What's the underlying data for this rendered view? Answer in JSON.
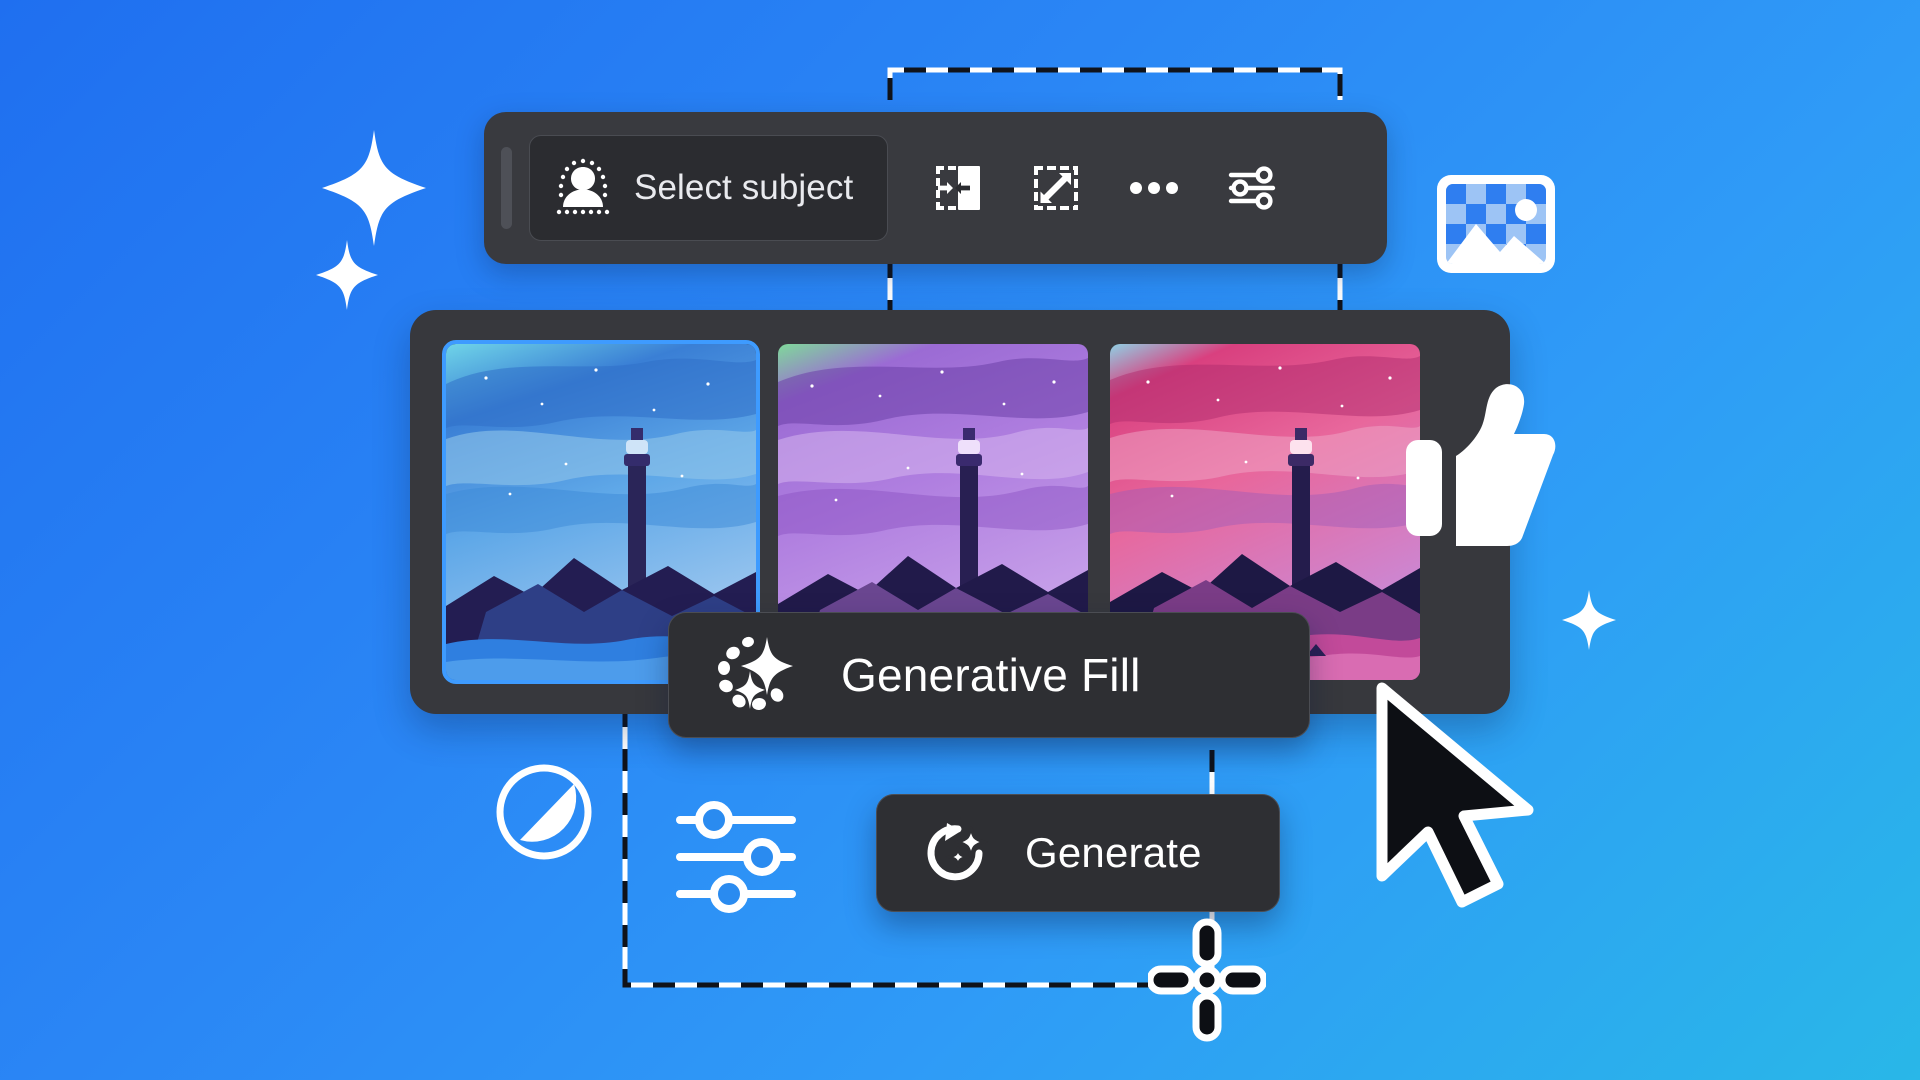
{
  "app": {
    "background_start": "#1f6ff0",
    "background_end": "#29b7e8",
    "panel_bg": "#37383d",
    "toolbar_bg": "#393a3f",
    "pill_bg": "#2e2f33",
    "accent": "#3e9bff"
  },
  "toolbar": {
    "grip_label": "drag-handle",
    "select_subject_label": "Select subject",
    "icons": [
      {
        "name": "select-subject-icon",
        "title": "Select subject"
      },
      {
        "name": "transform-horizontal-icon",
        "title": "Transform horizontally"
      },
      {
        "name": "scale-diagonal-icon",
        "title": "Scale selection"
      },
      {
        "name": "more-options-icon",
        "title": "More options"
      },
      {
        "name": "adjust-sliders-icon",
        "title": "Adjustments"
      }
    ]
  },
  "picture_icon": {
    "name": "image-placeholder-icon",
    "title": "Image"
  },
  "results_panel": {
    "variations": [
      {
        "name": "variation-1",
        "title": "Blue aurora lighthouse",
        "selected": true,
        "sky_top": "#6fd4e8",
        "sky_a": "#3a7fd5",
        "sky_b": "#5fa8e8",
        "sky_c": "#9fc8ef",
        "rock": "#231d52",
        "rock2": "#2e3f86",
        "water": "#2f7fe0"
      },
      {
        "name": "variation-2",
        "title": "Purple aurora lighthouse",
        "selected": false,
        "sky_top": "#7fd99a",
        "sky_a": "#9b6bd4",
        "sky_b": "#b07fe0",
        "sky_c": "#c9a3ea",
        "rock": "#211a4a",
        "rock2": "#6a4690",
        "water": "#8a5fc4"
      },
      {
        "name": "variation-3",
        "title": "Pink aurora lighthouse",
        "selected": false,
        "sky_top": "#8fd0e4",
        "sky_a": "#d9407f",
        "sky_b": "#e8679c",
        "sky_c": "#c98ad8",
        "rock": "#1d1844",
        "rock2": "#7a3c86",
        "water": "#c24a9a"
      }
    ]
  },
  "generative_fill_pill": {
    "label": "Generative Fill",
    "icon": {
      "name": "generative-sparkle-icon",
      "title": "Generative Fill"
    }
  },
  "generate_pill": {
    "label": "Generate",
    "icon": {
      "name": "generate-refresh-sparkle-icon",
      "title": "Generate"
    }
  },
  "decorations": {
    "sparkle_large": {
      "name": "sparkle-large-icon"
    },
    "sparkle_small": {
      "name": "sparkle-small-icon"
    },
    "sparkle_right": {
      "name": "sparkle-right-icon"
    },
    "contrast": {
      "name": "contrast-icon",
      "title": "Contrast"
    },
    "sliders": {
      "name": "sliders-icon",
      "title": "Adjustments"
    },
    "crosshair": {
      "name": "move-crosshair-icon",
      "title": "Move"
    },
    "thumbs_up": {
      "name": "thumbs-up-icon",
      "title": "Like"
    },
    "cursor": {
      "name": "mouse-cursor-icon",
      "title": "Pointer"
    }
  }
}
